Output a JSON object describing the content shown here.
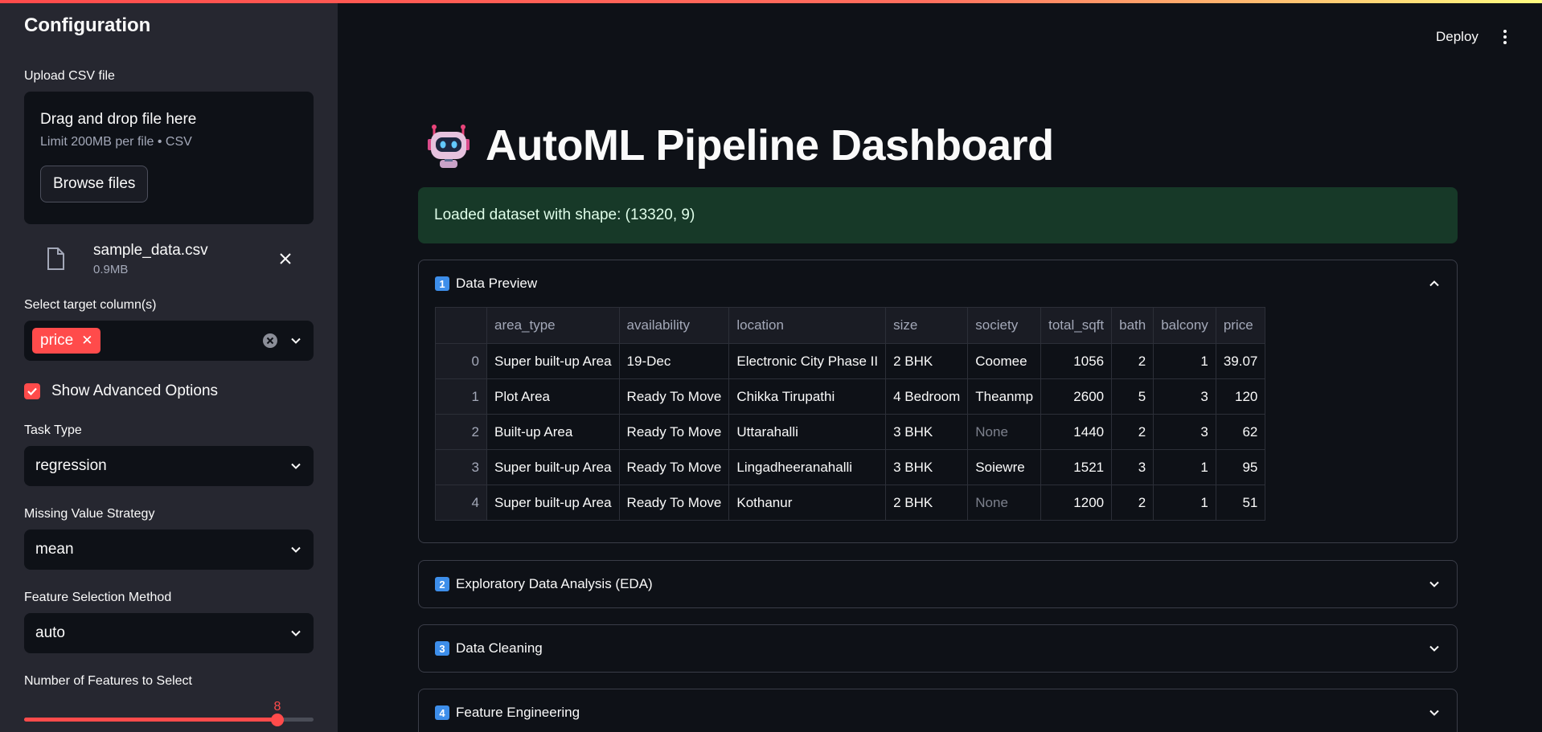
{
  "sidebar": {
    "title": "Configuration",
    "upload": {
      "label": "Upload CSV file",
      "dropzone_title": "Drag and drop file here",
      "dropzone_limit": "Limit 200MB per file • CSV",
      "browse_label": "Browse files",
      "file_name": "sample_data.csv",
      "file_size": "0.9MB"
    },
    "target": {
      "label": "Select target column(s)",
      "selected_tag": "price"
    },
    "advanced": {
      "label": "Show Advanced Options",
      "checked": true
    },
    "task_type": {
      "label": "Task Type",
      "value": "regression"
    },
    "missing": {
      "label": "Missing Value Strategy",
      "value": "mean"
    },
    "feature_sel": {
      "label": "Feature Selection Method",
      "value": "auto"
    },
    "num_features": {
      "label": "Number of Features to Select",
      "value": "8",
      "fraction": 0.875
    }
  },
  "header": {
    "deploy_label": "Deploy"
  },
  "main": {
    "title": "AutoML Pipeline Dashboard",
    "alert": "Loaded dataset with shape: (13320, 9)",
    "sections": [
      {
        "num": "1",
        "title": "Data Preview",
        "expanded": true
      },
      {
        "num": "2",
        "title": "Exploratory Data Analysis (EDA)"
      },
      {
        "num": "3",
        "title": "Data Cleaning"
      },
      {
        "num": "4",
        "title": "Feature Engineering"
      }
    ],
    "table": {
      "columns": [
        "",
        "area_type",
        "availability",
        "location",
        "size",
        "society",
        "total_sqft",
        "bath",
        "balcony",
        "price"
      ],
      "rows": [
        [
          "0",
          "Super built-up  Area",
          "19-Dec",
          "Electronic City Phase II",
          "2 BHK",
          "Coomee",
          "1056",
          "2",
          "1",
          "39.07"
        ],
        [
          "1",
          "Plot  Area",
          "Ready To Move",
          "Chikka Tirupathi",
          "4 Bedroom",
          "Theanmp",
          "2600",
          "5",
          "3",
          "120"
        ],
        [
          "2",
          "Built-up  Area",
          "Ready To Move",
          "Uttarahalli",
          "3 BHK",
          "None",
          "1440",
          "2",
          "3",
          "62"
        ],
        [
          "3",
          "Super built-up  Area",
          "Ready To Move",
          "Lingadheeranahalli",
          "3 BHK",
          "Soiewre",
          "1521",
          "3",
          "1",
          "95"
        ],
        [
          "4",
          "Super built-up  Area",
          "Ready To Move",
          "Kothanur",
          "2 BHK",
          "None",
          "1200",
          "2",
          "1",
          "51"
        ]
      ]
    }
  },
  "colors": {
    "accent": "#ff4b4b",
    "info": "#3d8eea",
    "success_bg": "#173928"
  }
}
